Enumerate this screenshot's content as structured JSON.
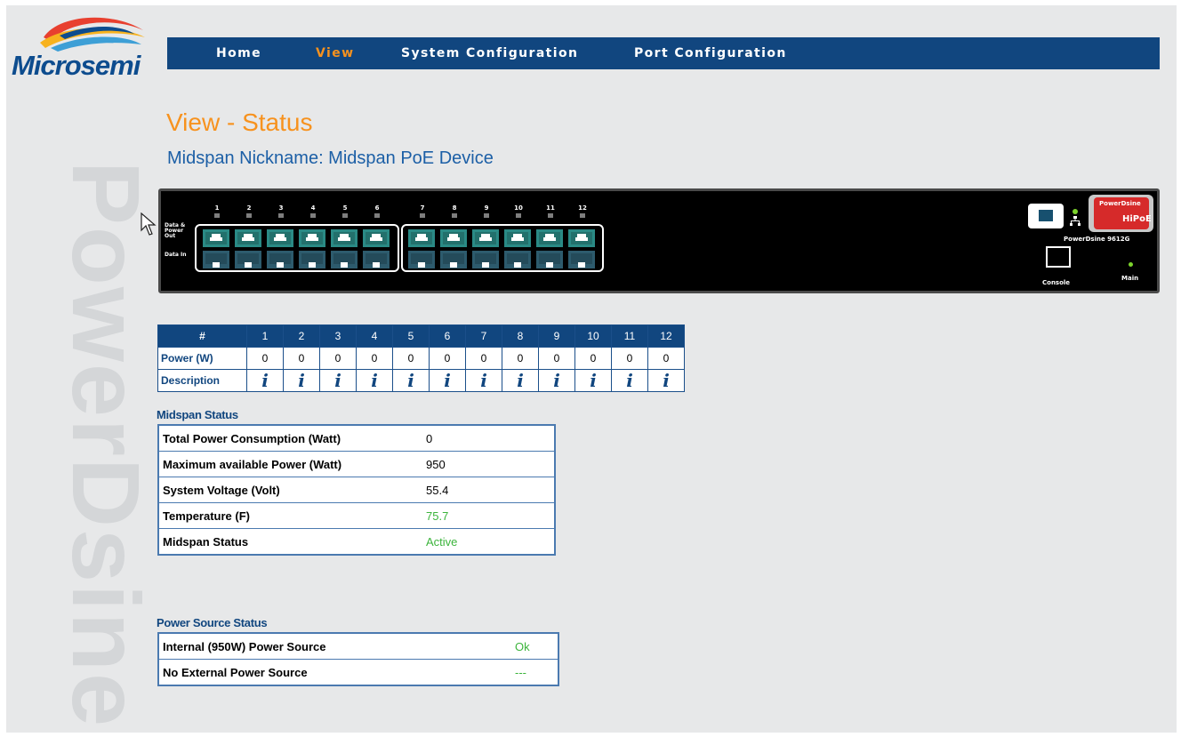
{
  "brand": {
    "logo_text": "Microsemi",
    "watermark": "PowerDsine"
  },
  "nav": {
    "items": [
      {
        "label": "Home",
        "active": false
      },
      {
        "label": "View",
        "active": true
      },
      {
        "label": "System Configuration",
        "active": false
      },
      {
        "label": "Port Configuration",
        "active": false
      }
    ]
  },
  "page": {
    "title": "View - Status",
    "subtitle": "Midspan Nickname: Midspan PoE Device"
  },
  "device": {
    "port_numbers": [
      "1",
      "2",
      "3",
      "4",
      "5",
      "6",
      "7",
      "8",
      "9",
      "10",
      "11",
      "12"
    ],
    "label_data_power": [
      "Data &",
      "Power",
      "Out"
    ],
    "label_data_in": "Data In",
    "model": "PowerDsine 9612G",
    "badge_top": "PowerDsine",
    "badge_bottom": "HiPoE",
    "console_label": "Console",
    "main_label": "Main"
  },
  "port_table": {
    "header_label": "#",
    "power_label": "Power (W)",
    "description_label": "Description",
    "ports": [
      "1",
      "2",
      "3",
      "4",
      "5",
      "6",
      "7",
      "8",
      "9",
      "10",
      "11",
      "12"
    ],
    "power": [
      "0",
      "0",
      "0",
      "0",
      "0",
      "0",
      "0",
      "0",
      "0",
      "0",
      "0",
      "0"
    ],
    "description_icon": "i"
  },
  "midspan_status": {
    "title": "Midspan Status",
    "rows": [
      {
        "label": "Total Power Consumption (Watt)",
        "value": "0"
      },
      {
        "label": "Maximum available Power (Watt)",
        "value": "950"
      },
      {
        "label": "System Voltage (Volt)",
        "value": "55.4"
      },
      {
        "label": "Temperature (F)",
        "value": "75.7"
      },
      {
        "label": "Midspan Status",
        "value": "Active"
      }
    ]
  },
  "power_source_status": {
    "title": "Power Source Status",
    "rows": [
      {
        "label": "Internal (950W) Power Source",
        "value": "Ok"
      },
      {
        "label": "No External Power Source",
        "value": "---"
      }
    ]
  },
  "colors": {
    "nav_bg": "#11467f",
    "accent_orange": "#f7921e",
    "link_blue": "#1c5fa6",
    "status_green": "#3cb43c"
  }
}
